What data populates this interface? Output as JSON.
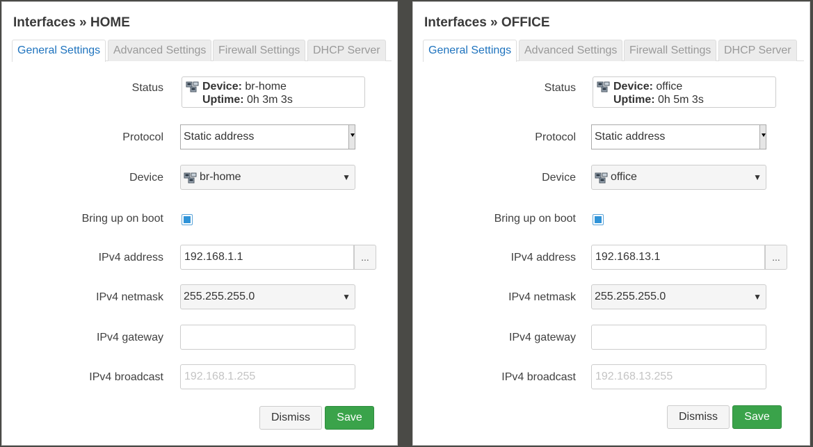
{
  "panels": [
    {
      "title": "Interfaces » HOME",
      "tabs": [
        "General Settings",
        "Advanced Settings",
        "Firewall Settings",
        "DHCP Server"
      ],
      "active_tab": "General Settings",
      "labels": {
        "status": "Status",
        "protocol": "Protocol",
        "device": "Device",
        "boot": "Bring up on boot",
        "ipv4_address": "IPv4 address",
        "ipv4_netmask": "IPv4 netmask",
        "ipv4_gateway": "IPv4 gateway",
        "ipv4_broadcast": "IPv4 broadcast"
      },
      "status": {
        "device_label": "Device:",
        "device_value": "br-home",
        "uptime_label": "Uptime:",
        "uptime_value": "0h 3m 3s"
      },
      "protocol_value": "Static address",
      "device_value": "br-home",
      "bring_up_on_boot": true,
      "ipv4_address": "192.168.1.1",
      "ipv4_netmask": "255.255.255.0",
      "ipv4_gateway": "",
      "ipv4_broadcast_placeholder": "192.168.1.255",
      "ellipsis": "...",
      "dismiss": "Dismiss",
      "save": "Save"
    },
    {
      "title": "Interfaces » OFFICE",
      "tabs": [
        "General Settings",
        "Advanced Settings",
        "Firewall Settings",
        "DHCP Server"
      ],
      "active_tab": "General Settings",
      "labels": {
        "status": "Status",
        "protocol": "Protocol",
        "device": "Device",
        "boot": "Bring up on boot",
        "ipv4_address": "IPv4 address",
        "ipv4_netmask": "IPv4 netmask",
        "ipv4_gateway": "IPv4 gateway",
        "ipv4_broadcast": "IPv4 broadcast"
      },
      "status": {
        "device_label": "Device:",
        "device_value": "office",
        "uptime_label": "Uptime:",
        "uptime_value": "0h 5m 3s"
      },
      "protocol_value": "Static address",
      "device_value": "office",
      "bring_up_on_boot": true,
      "ipv4_address": "192.168.13.1",
      "ipv4_netmask": "255.255.255.0",
      "ipv4_gateway": "",
      "ipv4_broadcast_placeholder": "192.168.13.255",
      "ellipsis": "...",
      "dismiss": "Dismiss",
      "save": "Save"
    }
  ],
  "icons": {
    "network": "network-ports-icon",
    "dropdown": "dropdown-arrow-icon"
  },
  "colors": {
    "active_tab": "#1e73be",
    "save": "#3aa34a",
    "checkbox": "#2f93d8"
  }
}
